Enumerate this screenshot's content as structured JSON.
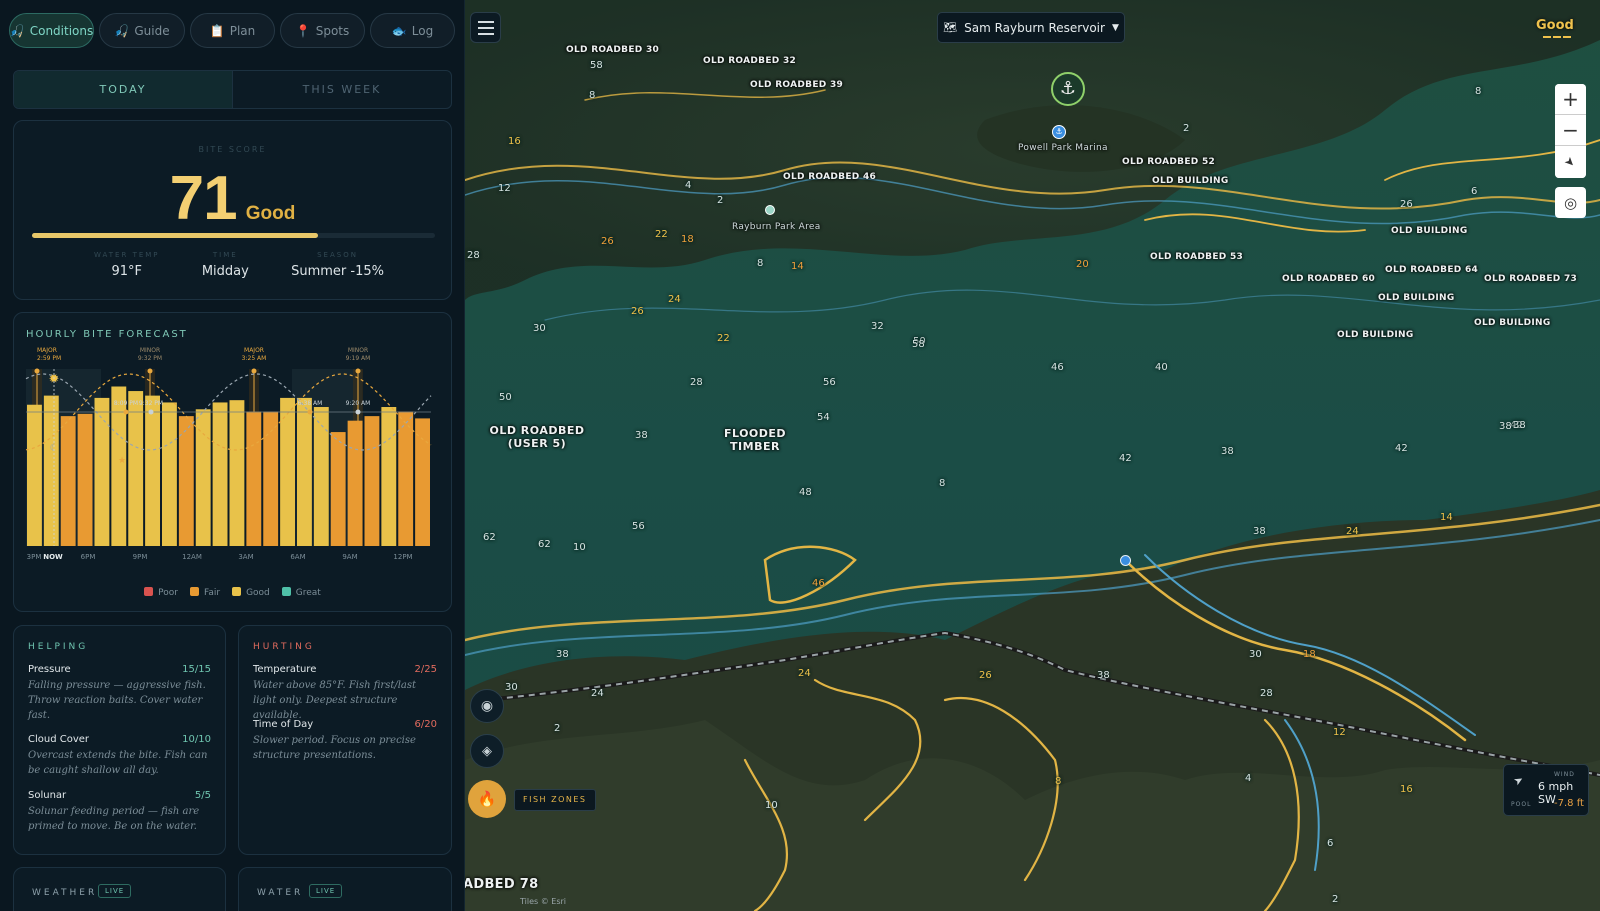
{
  "nav": {
    "tabs": [
      {
        "label": "Conditions",
        "icon": "🎣",
        "active": true
      },
      {
        "label": "Guide",
        "icon": "🎣"
      },
      {
        "label": "Plan",
        "icon": "📋"
      },
      {
        "label": "Spots",
        "icon": "📍"
      },
      {
        "label": "Log",
        "icon": "🐟"
      }
    ]
  },
  "period_tabs": {
    "today": "TODAY",
    "week": "THIS WEEK"
  },
  "bite": {
    "label": "BITE SCORE",
    "score": "71",
    "rating": "Good",
    "score_fraction": 0.71,
    "stats": [
      {
        "label": "WATER TEMP",
        "value": "91°F"
      },
      {
        "label": "TIME",
        "value": "Midday"
      },
      {
        "label": "SEASON",
        "value": "Summer -15%"
      }
    ]
  },
  "hourly": {
    "title": "HOURLY BITE FORECAST",
    "events": [
      {
        "type": "MAJOR",
        "time": "2:59 PM"
      },
      {
        "type": "MINOR",
        "time": "9:32 PM"
      },
      {
        "type": "MAJOR",
        "time": "3:25 AM"
      },
      {
        "type": "MINOR",
        "time": "9:19 AM"
      }
    ],
    "curve_labels": [
      "8:09 PM",
      "9:32 PM",
      "6:38 AM",
      "9:20 AM"
    ],
    "x_ticks": [
      "3PM",
      "NOW",
      "6PM",
      "9PM",
      "12AM",
      "3AM",
      "6AM",
      "9AM",
      "12PM"
    ],
    "legend": [
      {
        "label": "Poor",
        "color": "#d9534f"
      },
      {
        "label": "Fair",
        "color": "#e89a32"
      },
      {
        "label": "Good",
        "color": "#e8c24a"
      },
      {
        "label": "Great",
        "color": "#4fc0a8"
      }
    ]
  },
  "chart_data": {
    "type": "bar",
    "title": "HOURLY BITE FORECAST",
    "categories": [
      "3PM",
      "NOW",
      "5PM",
      "6PM",
      "7PM",
      "8PM",
      "9PM",
      "10PM",
      "11PM",
      "12AM",
      "1AM",
      "2AM",
      "3AM",
      "4AM",
      "5AM",
      "6AM",
      "7AM",
      "8AM",
      "9AM",
      "10AM",
      "11AM",
      "12PM",
      "1PM",
      "2PM"
    ],
    "values": [
      62,
      66,
      57,
      58,
      65,
      70,
      68,
      66,
      63,
      57,
      60,
      63,
      64,
      59,
      59,
      65,
      65,
      61,
      50,
      55,
      57,
      61,
      59,
      56
    ],
    "ylim": [
      0,
      100
    ],
    "grid": false,
    "legend_position": "bottom"
  },
  "helping": {
    "title": "HELPING",
    "items": [
      {
        "name": "Pressure",
        "score": "15/15",
        "desc": "Falling pressure — aggressive fish. Throw reaction baits. Cover water fast."
      },
      {
        "name": "Cloud Cover",
        "score": "10/10",
        "desc": "Overcast extends the bite. Fish can be caught shallow all day."
      },
      {
        "name": "Solunar",
        "score": "5/5",
        "desc": "Solunar feeding period — fish are primed to move. Be on the water."
      }
    ]
  },
  "hurting": {
    "title": "HURTING",
    "items": [
      {
        "name": "Temperature",
        "score": "2/25",
        "desc": "Water above 85°F. Fish first/last light only. Deepest structure available."
      },
      {
        "name": "Time of Day",
        "score": "6/20",
        "desc": "Slower period. Focus on precise structure presentations."
      }
    ]
  },
  "weather": {
    "title": "WEATHER",
    "badge": "LIVE"
  },
  "water": {
    "title": "WATER",
    "badge": "LIVE"
  },
  "map": {
    "lake": "Sam Rayburn Reservoir",
    "rating": "Good",
    "fish_zones": "FISH ZONES",
    "wind_label": "WIND",
    "wind": "6 mph SW",
    "pool_label": "POOL",
    "pool": "-7.8 ft",
    "attribution": "Tiles © Esri",
    "labels": [
      "OLD ROADBED 30",
      "OLD ROADBED 32",
      "OLD ROADBED 39",
      "OLD ROADBED 46",
      "OLD ROADBED 52",
      "OLD BUILDING",
      "OLD ROADBED 53",
      "OLD ROADBED 60",
      "OLD ROADBED 64",
      "OLD BUILDING",
      "OLD BUILDING",
      "OLD BUILDING",
      "OLD ROADBED 73",
      "OLD BUILDING",
      "OLD ROADBED (USER 5)",
      "FLOODED TIMBER",
      "ADBED 78"
    ],
    "pois": [
      "Powell Park Marina",
      "Rayburn Park Area"
    ],
    "depths": [
      "8",
      "58",
      "16",
      "12",
      "4",
      "2",
      "26",
      "22",
      "18",
      "8",
      "14",
      "28",
      "24",
      "26",
      "30",
      "32",
      "22",
      "28",
      "50",
      "56",
      "54",
      "58",
      "50",
      "46",
      "38",
      "48",
      "62",
      "56",
      "62",
      "10",
      "46",
      "38",
      "30",
      "24",
      "24",
      "26",
      "8",
      "2",
      "38",
      "20",
      "10",
      "8",
      "42",
      "40",
      "42",
      "38",
      "42",
      "38",
      "38",
      "24",
      "14",
      "30",
      "18",
      "28",
      "12",
      "4",
      "6",
      "2",
      "16",
      "26",
      "38",
      "8",
      "6",
      "2"
    ]
  }
}
